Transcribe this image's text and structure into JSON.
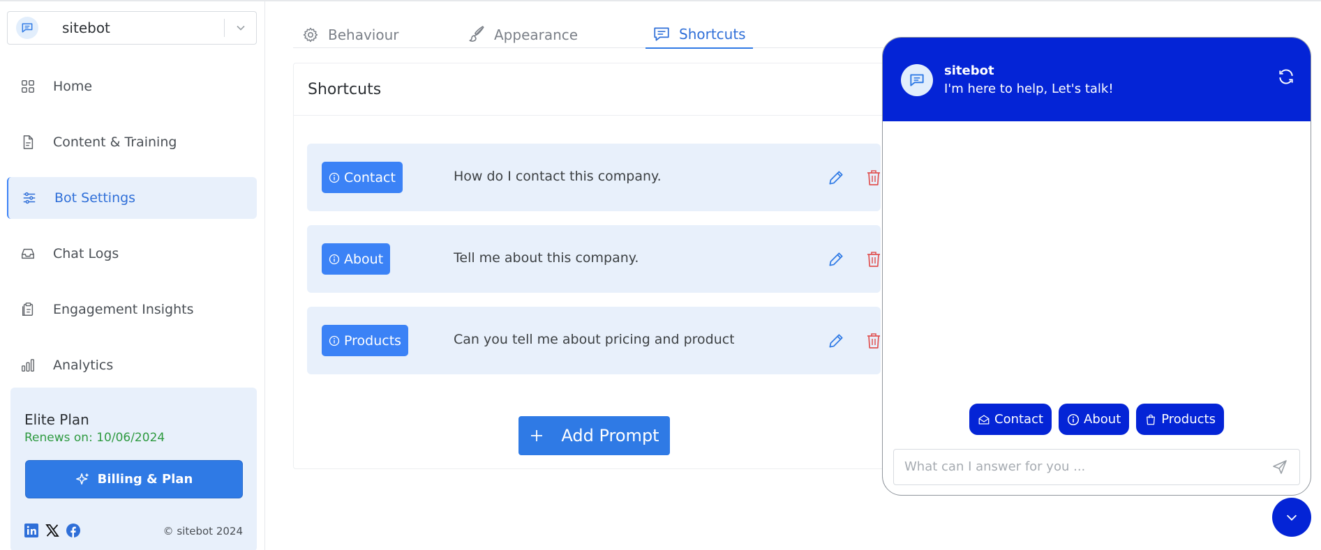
{
  "bot_selector": {
    "name": "sitebot"
  },
  "sidebar": {
    "items": [
      {
        "label": "Home",
        "icon": "grid-icon",
        "active": false
      },
      {
        "label": "Content & Training",
        "icon": "document-icon",
        "active": false
      },
      {
        "label": "Bot Settings",
        "icon": "sliders-icon",
        "active": true
      },
      {
        "label": "Chat Logs",
        "icon": "inbox-icon",
        "active": false
      },
      {
        "label": "Engagement Insights",
        "icon": "clipboard-icon",
        "active": false
      },
      {
        "label": "Analytics",
        "icon": "bar-chart-icon",
        "active": false
      }
    ],
    "plan": {
      "title": "Elite Plan",
      "renews": "Renews on: 10/06/2024",
      "billing_label": "Billing & Plan"
    },
    "copyright": "© sitebot 2024"
  },
  "tabs": [
    {
      "label": "Behaviour",
      "icon": "gear-icon",
      "active": false
    },
    {
      "label": "Appearance",
      "icon": "brush-icon",
      "active": false
    },
    {
      "label": "Shortcuts",
      "icon": "chat-icon",
      "active": true
    }
  ],
  "shortcuts": {
    "title": "Shortcuts",
    "rows": [
      {
        "label": "Contact",
        "prompt": "How do I contact this company."
      },
      {
        "label": "About",
        "prompt": "Tell me about this company."
      },
      {
        "label": "Products",
        "prompt": "Can you tell me about pricing and products of"
      }
    ],
    "add_label": "Add Prompt"
  },
  "chat": {
    "name": "sitebot",
    "subtitle": "I'm here to help, Let's talk!",
    "quick_replies": [
      {
        "label": "Contact",
        "icon": "mail-open-icon"
      },
      {
        "label": "About",
        "icon": "info-icon"
      },
      {
        "label": "Products",
        "icon": "shopping-bag-icon"
      }
    ],
    "input_placeholder": "What can I answer for you ..."
  },
  "colors": {
    "primary": "#2f7ae5",
    "chat_primary": "#0424d6",
    "active_bg": "#e8f0fb",
    "renew_green": "#2e9a40",
    "delete_red": "#e05252"
  }
}
